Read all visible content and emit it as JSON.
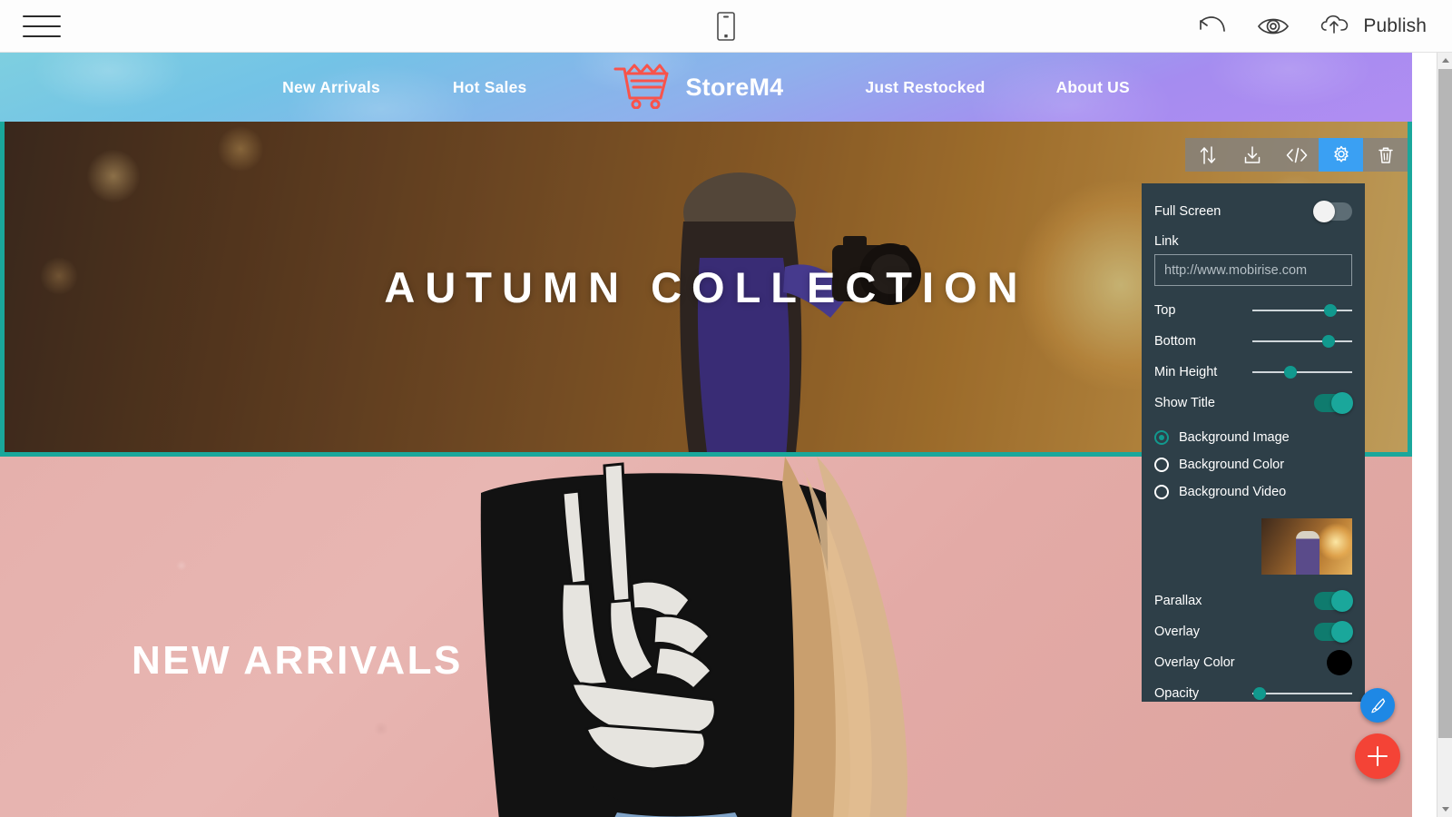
{
  "app_bar": {
    "menu_icon": "hamburger-menu-icon",
    "device_icon": "mobile-device-icon",
    "undo_icon": "undo-arrow-icon",
    "preview_icon": "eye-preview-icon",
    "publish_icon": "cloud-upload-icon",
    "publish_label": "Publish"
  },
  "site_nav": {
    "left_links": [
      "New Arrivals",
      "Hot Sales"
    ],
    "brand": {
      "icon": "shopping-cart-icon",
      "name": "StoreM4",
      "icon_color": "#f8534b"
    },
    "right_links": [
      "Just Restocked",
      "About US"
    ]
  },
  "hero": {
    "title": "AUTUMN COLLECTION",
    "selection_color": "#1aa79b"
  },
  "arrivals": {
    "title": "NEW ARRIVALS"
  },
  "element_toolbar": {
    "buttons": [
      {
        "name": "move-updown-icon",
        "label": "Move",
        "active": false
      },
      {
        "name": "download-icon",
        "label": "Download",
        "active": false
      },
      {
        "name": "code-icon",
        "label": "Code",
        "active": false
      },
      {
        "name": "gear-icon",
        "label": "Settings",
        "active": true
      },
      {
        "name": "trash-icon",
        "label": "Delete",
        "active": false
      }
    ],
    "active_color": "#3aa0f3"
  },
  "settings_panel": {
    "accent_color": "#11998e",
    "background_color": "#2e3f48",
    "full_screen": {
      "label": "Full Screen",
      "on": false
    },
    "link": {
      "label": "Link",
      "value": "",
      "placeholder": "http://www.mobirise.com"
    },
    "sliders": [
      {
        "label": "Top",
        "value": 72
      },
      {
        "label": "Bottom",
        "value": 70
      },
      {
        "label": "Min Height",
        "value": 32
      }
    ],
    "show_title": {
      "label": "Show Title",
      "on": true
    },
    "background_options": [
      {
        "label": "Background Image",
        "selected": true
      },
      {
        "label": "Background Color",
        "selected": false
      },
      {
        "label": "Background Video",
        "selected": false
      }
    ],
    "thumbnail_name": "background-image-thumbnail",
    "parallax": {
      "label": "Parallax",
      "on": true
    },
    "overlay": {
      "label": "Overlay",
      "on": true
    },
    "overlay_color": {
      "label": "Overlay Color",
      "value": "#000000"
    },
    "opacity": {
      "label": "Opacity",
      "value": 3
    }
  },
  "floating_buttons": {
    "pen": {
      "name": "paintbrush-icon",
      "color": "#1e88e5"
    },
    "add": {
      "name": "plus-icon",
      "color": "#f44336"
    }
  },
  "scrollbar": {
    "up_icon": "scroll-up-arrow",
    "down_icon": "scroll-down-arrow"
  }
}
